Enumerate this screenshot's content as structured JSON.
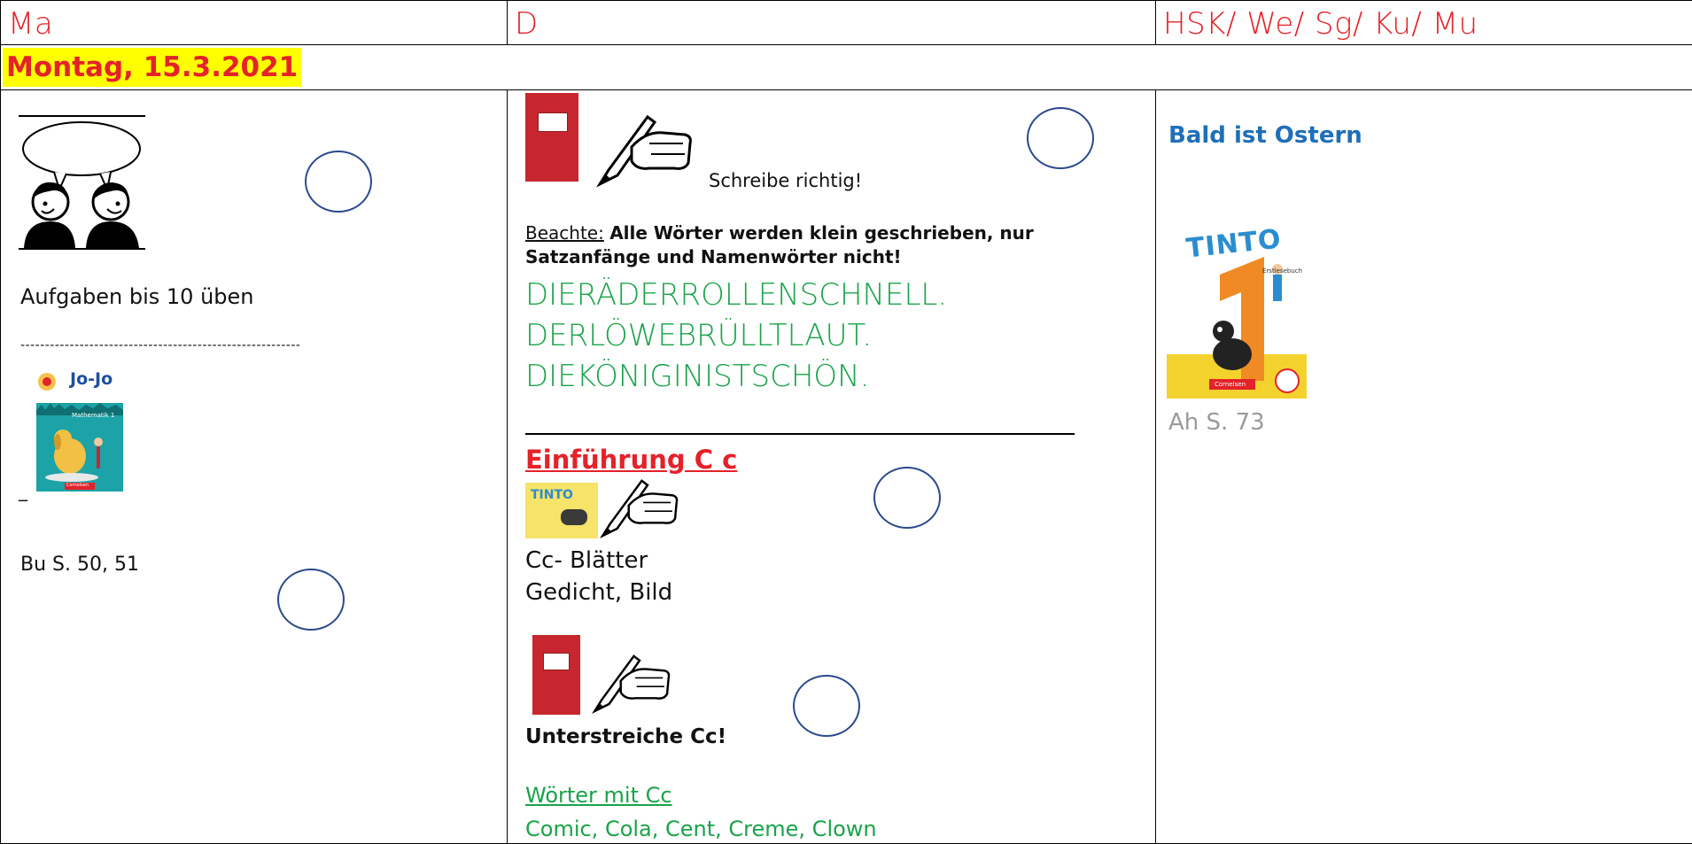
{
  "header": {
    "col1": "Ma",
    "col2": "D",
    "col3": "HSK/ We/ Sg/ Ku/ Mu"
  },
  "date": "Montag, 15.3.2021",
  "ma": {
    "task1": "Aufgaben bis 10 üben",
    "dashes": "---------------------------------------------------------",
    "book_brand": "Jo-Jo",
    "book_subtitle": "Mathematik 1",
    "book_publisher": "Cornelsen",
    "dash_short": "_",
    "task2": "Bu S. 50, 51"
  },
  "d": {
    "write_label": "Schreibe richtig!",
    "note_prefix": "Beachte:",
    "note_text": "Alle Wörter werden klein geschrieben, nur Satzanfänge und Namenwörter nicht!",
    "lines": [
      "DIERÄDERROLLENSCHNELL.",
      "DERLÖWEBRÜLLTLAUT.",
      "DIEKÖNIGINISTSCHÖN."
    ],
    "section_title": "Einführung C c",
    "sheets_line1": "Cc- Blätter",
    "sheets_line2": "Gedicht, Bild",
    "underline_task": "Unterstreiche Cc!",
    "words_title": "Wörter mit Cc",
    "words_list": "Comic, Cola, Cent, Creme, Clown"
  },
  "hsk": {
    "title": "Bald ist Ostern",
    "book_brand": "TINTO",
    "book_subtitle": "Erstlesebuch",
    "book_publisher": "Cornelsen",
    "page_ref": "Ah S. 73"
  },
  "colors": {
    "header_red": "#e4222a",
    "highlight_yellow": "#ffff00",
    "green": "#1aa34a",
    "blue_title": "#1f6fb8",
    "circle_blue": "#2b4a8c"
  }
}
